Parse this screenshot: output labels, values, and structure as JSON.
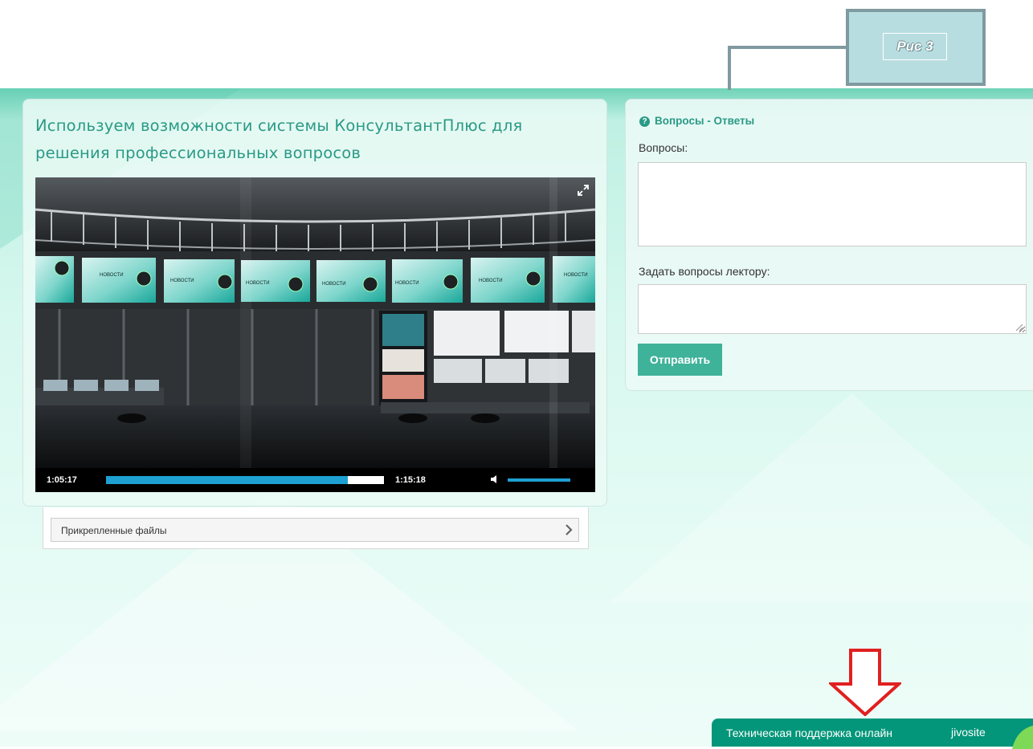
{
  "annotation": {
    "label": "Рис 3"
  },
  "lesson": {
    "title": "Используем возможности системы КонсультантПлюс для решения профессиональных вопросов"
  },
  "video": {
    "current_time": "1:05:17",
    "duration": "1:15:18",
    "progress_fraction": 0.87,
    "volume_fraction": 1.0,
    "screen_captions": [
      "НОВОСТИ",
      "НОВОСТИ",
      "НОВОСТИ",
      "НОВОСТИ",
      "НОВОСТИ",
      "НОВОСТИ",
      "НОВОСТИ"
    ]
  },
  "attachments": {
    "label": "Прикрепленные файлы"
  },
  "qa": {
    "heading": "Вопросы - Ответы",
    "questions_label": "Вопросы:",
    "ask_label": "Задать вопросы лектору:",
    "ask_value": "",
    "send_label": "Отправить"
  },
  "support": {
    "label": "Техническая поддержка онлайн",
    "brand": "jivosite"
  },
  "colors": {
    "accent": "#2a9a86",
    "button": "#3fb29a",
    "support_bar": "#04967a",
    "progress": "#1ea0d2",
    "arrow": "#e02020"
  }
}
